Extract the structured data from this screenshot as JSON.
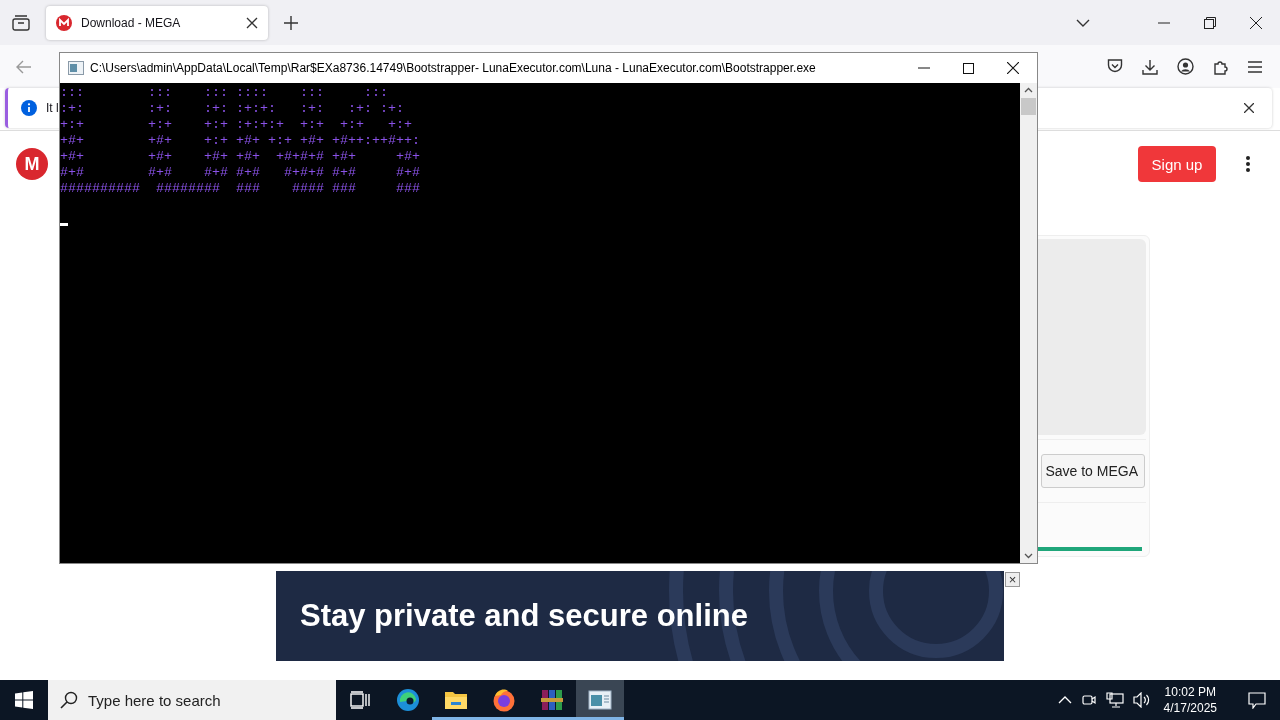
{
  "browser": {
    "tabs": [
      {
        "title": "Download - MEGA",
        "selected": true
      }
    ],
    "notification": {
      "text": "It l"
    }
  },
  "page": {
    "logo_letter": "M",
    "signup": "Sign up",
    "save_button": "Save to MEGA"
  },
  "ad": {
    "headline": "Stay private and secure online",
    "close": "×"
  },
  "console": {
    "title": "C:\\Users\\admin\\AppData\\Local\\Temp\\Rar$EXa8736.14749\\Bootstrapper- LunaExecutor.com\\Luna - LunaExecutor.com\\Bootstrapper.exe",
    "lines": [
      ":::        :::    ::: ::::    :::     :::",
      ":+:        :+:    :+: :+:+:   :+:   :+: :+:",
      "+:+        +:+    +:+ :+:+:+  +:+  +:+   +:+",
      "+#+        +#+    +:+ +#+ +:+ +#+ +#++:++#++:",
      "+#+        +#+    +#+ +#+  +#+#+# +#+     +#+",
      "#+#        #+#    #+# #+#   #+#+# #+#     #+#",
      "##########  ########  ###    #### ###     ###"
    ]
  },
  "taskbar": {
    "search_placeholder": "Type here to search",
    "apps": [
      {
        "kind": "taskview",
        "running": false,
        "selected": false
      },
      {
        "kind": "edge",
        "running": false,
        "selected": false
      },
      {
        "kind": "explorer",
        "running": true,
        "selected": false
      },
      {
        "kind": "firefox",
        "running": true,
        "selected": false
      },
      {
        "kind": "winrar",
        "running": true,
        "selected": false
      },
      {
        "kind": "console",
        "running": true,
        "selected": true
      }
    ],
    "time": "10:02 PM",
    "date": "4/17/2025"
  }
}
